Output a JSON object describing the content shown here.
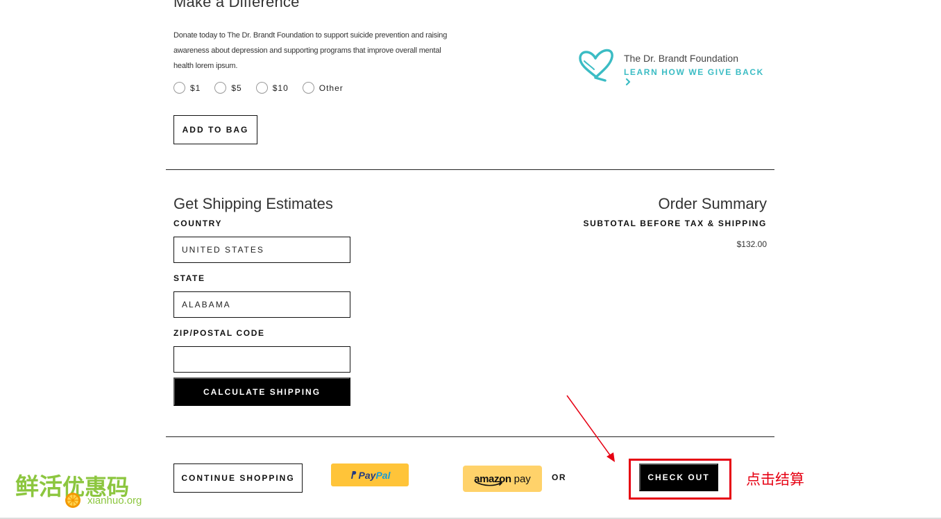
{
  "donation": {
    "title": "Make a Difference",
    "description": "Donate today to The Dr. Brandt Foundation to support suicide prevention and raising awareness about depression and supporting programs that improve overall mental health lorem ipsum.",
    "options": [
      {
        "label": "$1"
      },
      {
        "label": "$5"
      },
      {
        "label": "$10"
      },
      {
        "label": "Other"
      }
    ],
    "add_to_bag_label": "ADD TO BAG"
  },
  "foundation": {
    "name": "The Dr. Brandt Foundation",
    "link_label": "LEARN HOW WE GIVE BACK",
    "accent_color": "#3bbcc4"
  },
  "shipping": {
    "title": "Get Shipping Estimates",
    "country_label": "COUNTRY",
    "country_value": "UNITED STATES",
    "state_label": "STATE",
    "state_value": "ALABAMA",
    "zip_label": "ZIP/POSTAL CODE",
    "zip_value": "",
    "calculate_label": "CALCULATE SHIPPING"
  },
  "summary": {
    "title": "Order Summary",
    "subtotal_label": "SUBTOTAL BEFORE TAX & SHIPPING",
    "subtotal_value": "$132.00"
  },
  "actions": {
    "continue_label": "CONTINUE SHOPPING",
    "paypal_part1": "Pay",
    "paypal_part2": "Pal",
    "amazon_part1": "amazon",
    "amazon_part2": "pay",
    "or_label": "OR",
    "checkout_label": "CHECK OUT"
  },
  "annotation": {
    "text": "点击结算",
    "color": "#e60012"
  },
  "watermark": {
    "title_part1": "鲜活",
    "title_part2": "优惠码",
    "subtitle": "xianhuo.org"
  }
}
